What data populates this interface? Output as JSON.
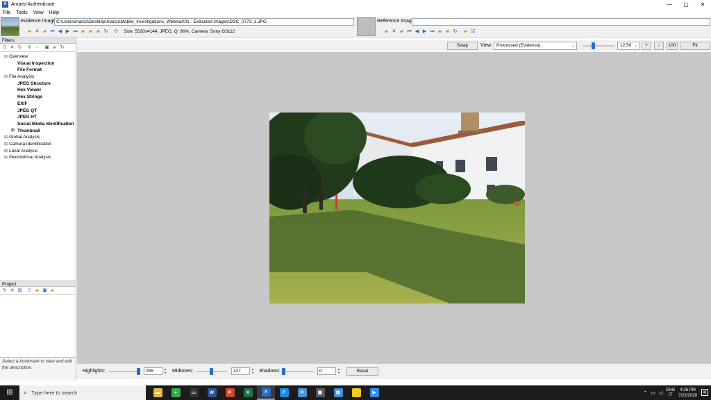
{
  "window": {
    "title": "Amped Authenticate",
    "app_icon": "amped-authenticate-icon",
    "controls": {
      "minimize": "—",
      "maximize": "▢",
      "close": "✕"
    }
  },
  "menu": [
    "File",
    "Tools",
    "View",
    "Help"
  ],
  "evidence": {
    "label": "Evidence Image:",
    "path": "C:\\Users\\marco\\Desktop\\marco\\Mobile_Investigations_Webinar\\01 - Extracted images\\DSC_0773_1.JPG",
    "info": "Size: 5520x4144, JPEG, Q: 96%, Camera: Sony G3112"
  },
  "reference": {
    "label": "Reference Image:",
    "path": ""
  },
  "filters": {
    "header": "Filters",
    "tree": [
      {
        "label": "Overview",
        "level": 0,
        "expander": "⊟"
      },
      {
        "label": "Visual Inspection",
        "level": 1
      },
      {
        "label": "File Format",
        "level": 1
      },
      {
        "label": "File Analysis",
        "level": 0,
        "expander": "⊟"
      },
      {
        "label": "JPEG Structure",
        "level": 1
      },
      {
        "label": "Hex Viewer",
        "level": 1
      },
      {
        "label": "Hex Strings",
        "level": 1
      },
      {
        "label": "EXIF",
        "level": 1
      },
      {
        "label": "JPEG QT",
        "level": 1
      },
      {
        "label": "JPEG HT",
        "level": 1
      },
      {
        "label": "Social Media Identification",
        "level": 1
      },
      {
        "label": "Thumbnail",
        "level": 1,
        "expander": "⊞"
      },
      {
        "label": "Global Analysis",
        "level": 0,
        "expander": "⊞"
      },
      {
        "label": "Camera Identification",
        "level": 0,
        "expander": "⊞"
      },
      {
        "label": "Local Analysis",
        "level": 0,
        "expander": "⊞"
      },
      {
        "label": "Geometrical Analysis",
        "level": 0,
        "expander": "⊞"
      }
    ]
  },
  "project": {
    "header": "Project",
    "bookmark_hint": "Select a bookmark to view and edit the description."
  },
  "view_toolbar": {
    "swap_label": "Swap",
    "view_label": "View:",
    "view_selected": "Processed (Evidence)",
    "zoom_value": "12.50",
    "zoom_position": 0.28,
    "plus_label": "+",
    "minus_label": "-",
    "hundred_label": "100",
    "fit_label": "Fit"
  },
  "levels": {
    "highlights_label": "Highlights:",
    "highlights_value": "255",
    "midtones_label": "Midtones:",
    "midtones_value": "127",
    "shadows_label": "Shadows:",
    "shadows_value": "0",
    "reset_label": "Reset"
  },
  "taskbar": {
    "search_placeholder": "Type here to search",
    "apps": [
      {
        "name": "file-explorer",
        "glyph": "▬",
        "color": "#e8b84a"
      },
      {
        "name": "chrome",
        "glyph": "●",
        "color": "#34a853"
      },
      {
        "name": "terminal",
        "glyph": "▭",
        "color": "#333333"
      },
      {
        "name": "word",
        "glyph": "W",
        "color": "#2b579a"
      },
      {
        "name": "powerpoint",
        "glyph": "P",
        "color": "#d24726"
      },
      {
        "name": "excel",
        "glyph": "X",
        "color": "#217346"
      },
      {
        "name": "amped-authenticate",
        "glyph": "A",
        "color": "#2b6cc4"
      },
      {
        "name": "amped-five",
        "glyph": "F",
        "color": "#1e88e5"
      },
      {
        "name": "amped-replay",
        "glyph": "R",
        "color": "#4a90d9"
      },
      {
        "name": "photos",
        "glyph": "▣",
        "color": "#5a5a5a"
      },
      {
        "name": "network",
        "glyph": "▤",
        "color": "#3d8fd6"
      },
      {
        "name": "sticky-notes",
        "glyph": "▪",
        "color": "#f2c811"
      },
      {
        "name": "zoom",
        "glyph": "▶",
        "color": "#2d8cff"
      }
    ],
    "lang_top": "ENG",
    "lang_bottom": "IT",
    "time": "4:26 PM",
    "date": "7/22/2020"
  }
}
